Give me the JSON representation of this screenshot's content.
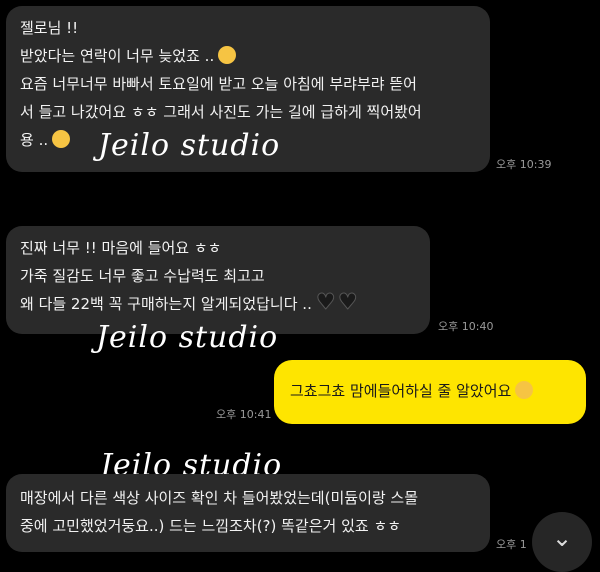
{
  "messages": [
    {
      "sender": "other",
      "lines": [
        "젤로님 !!",
        "받았다는 연락이 너무 늦었죠 ..",
        "요즘 너무너무 바빠서 토요일에 받고 오늘 아침에 부랴부랴 뜯어",
        "서 들고 나갔어요 ㅎㅎ 그래서 사진도 가는 길에 급하게 찍어봤어",
        "용 .."
      ],
      "time": "오후 10:39"
    },
    {
      "sender": "other",
      "lines": [
        "진짜 너무 !! 마음에 들어요 ㅎㅎ",
        "가죽 질감도 너무 좋고 수납력도 최고고",
        "왜 다들 22백 꼭 구매하는지 알게되었답니다 .."
      ],
      "time": "오후 10:40"
    },
    {
      "sender": "me",
      "lines": [
        "그쵸그쵸 맘에들어하실 줄 알았어요"
      ],
      "time": "오후 10:41"
    },
    {
      "sender": "other",
      "lines": [
        "매장에서 다른 색상 사이즈 확인 차 들어봤었는데(미듐이랑 스몰",
        "중에 고민했었거둥요..) 드는 느낌조차(?) 똑같은거 있죠 ㅎㅎ"
      ],
      "time": "오후 1"
    }
  ],
  "watermark": "Jeilo studio",
  "icons": {
    "pleading_emoji": "pleading-face-icon",
    "shy_emoji": "shushing-face-icon",
    "hearts": "black-heart-icon",
    "smirk_emoji": "smirking-face-icon",
    "scroll_down": "chevron-down-icon"
  },
  "colors": {
    "background": "#000000",
    "other_bubble": "#2a2a2a",
    "my_bubble": "#fee500"
  }
}
